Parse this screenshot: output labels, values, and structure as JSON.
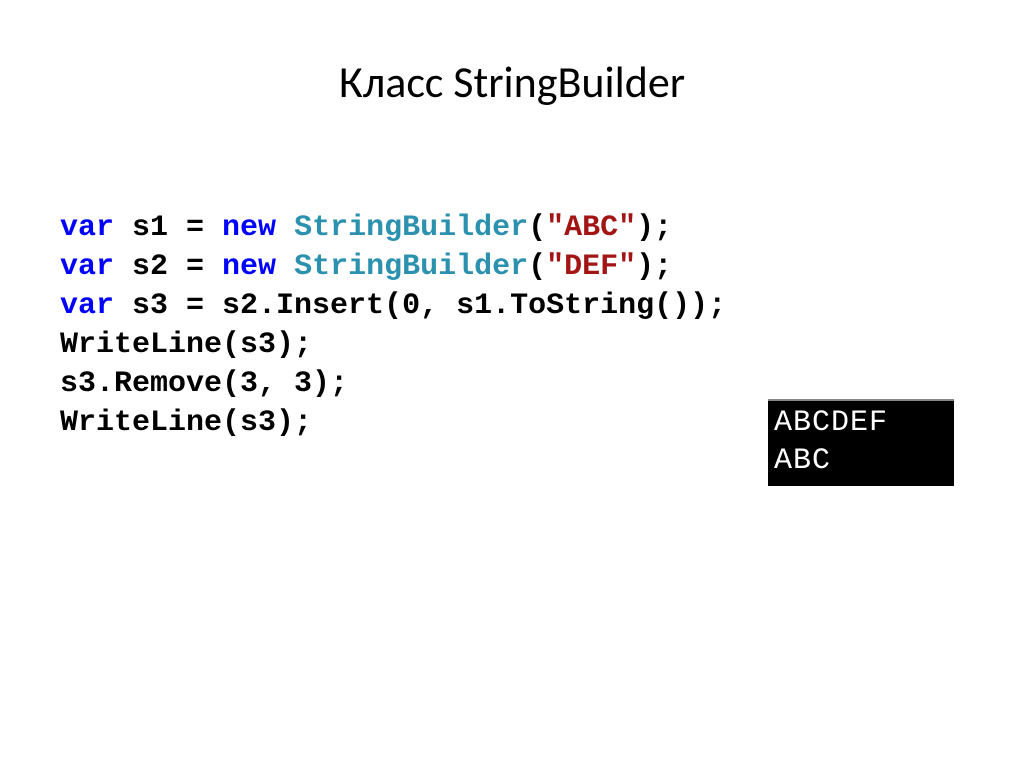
{
  "title": "Класс StringBuilder",
  "code": {
    "line1": {
      "var": "var",
      "s1": " s1 = ",
      "new": "new",
      "sp": " ",
      "type": "StringBuilder",
      "open": "(",
      "str": "\"ABC\"",
      "close": ");"
    },
    "line2": {
      "var": "var",
      "s2": " s2 = ",
      "new": "new",
      "sp": " ",
      "type": "StringBuilder",
      "open": "(",
      "str": "\"DEF\"",
      "close": ");"
    },
    "line3": {
      "var": "var",
      "rest": " s3 = s2.Insert(0, s1.ToString());"
    },
    "line4": "WriteLine(s3);",
    "line5": "s3.Remove(3, 3);",
    "line6": "WriteLine(s3);"
  },
  "output": {
    "line1": "ABCDEF",
    "line2": "ABC"
  }
}
